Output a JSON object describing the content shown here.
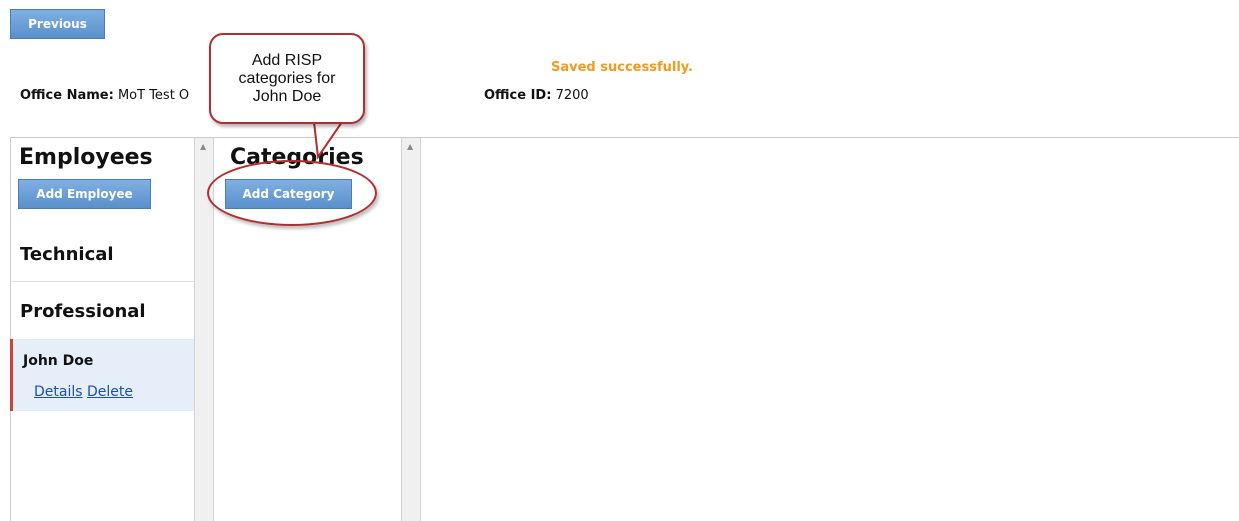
{
  "toolbar": {
    "previous_label": "Previous"
  },
  "header": {
    "office_name_label": "Office Name:",
    "office_name_value": "MoT Test O",
    "office_id_label": "Office ID:",
    "office_id_value": "7200",
    "status_message": "Saved successfully."
  },
  "employees": {
    "title": "Employees",
    "add_button": "Add Employee",
    "groups": [
      {
        "label": "Technical"
      },
      {
        "label": "Professional"
      }
    ],
    "selected": {
      "name": "John Doe",
      "details_link": "Details",
      "delete_link": "Delete"
    }
  },
  "categories": {
    "title": "Categories",
    "add_button": "Add Category"
  },
  "callout": {
    "text": "Add RISP categories for John Doe"
  },
  "colors": {
    "accent_button": "#5a8fcb",
    "status_orange": "#f39a1d",
    "callout_red": "#b22d2d",
    "selected_row_bg": "#e6eefa",
    "selected_row_marker": "#c9453a"
  },
  "icons": {
    "scroll_up": "scroll-up-arrow-icon"
  }
}
